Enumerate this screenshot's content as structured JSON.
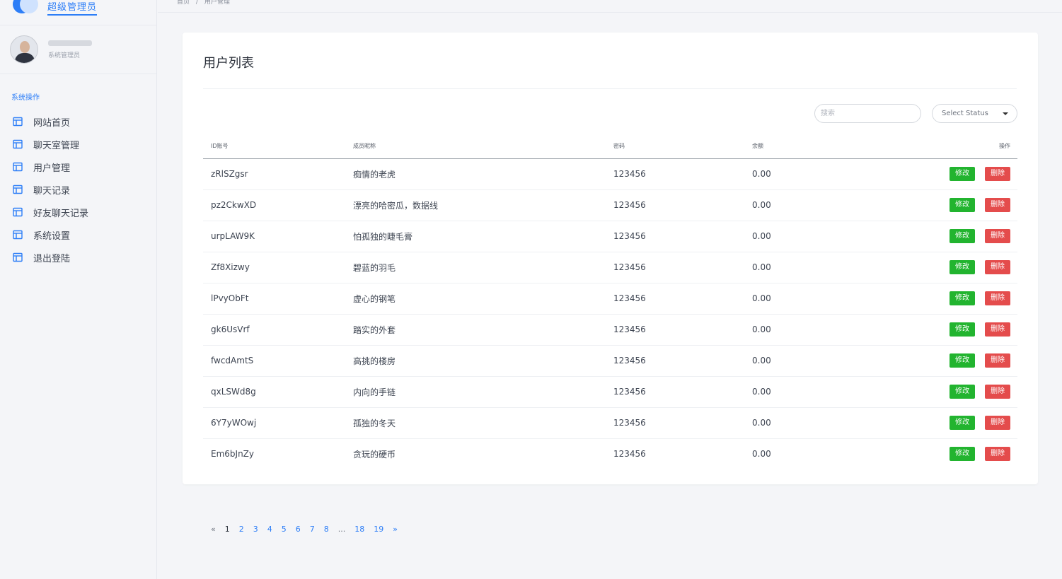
{
  "brand": {
    "title": "超级管理员"
  },
  "profile": {
    "role": "系统管理员"
  },
  "sidebar": {
    "section": "系统操作",
    "items": [
      {
        "label": "网站首页"
      },
      {
        "label": "聊天室管理"
      },
      {
        "label": "用户管理"
      },
      {
        "label": "聊天记录"
      },
      {
        "label": "好友聊天记录"
      },
      {
        "label": "系统设置"
      },
      {
        "label": "退出登陆"
      }
    ]
  },
  "breadcrumb": {
    "home": "首页",
    "sep": "/",
    "current": "用户管理"
  },
  "card": {
    "title": "用户列表",
    "search_placeholder": "搜索",
    "select_label": "Select Status"
  },
  "table": {
    "headers": {
      "id": "ID账号",
      "nickname": "成员昵称",
      "password": "密码",
      "balance": "余额",
      "ops": "操作"
    },
    "edit_label": "修改",
    "delete_label": "删除",
    "rows": [
      {
        "id": "zRlSZgsr",
        "nickname": "痴情的老虎",
        "password": "123456",
        "balance": "0.00"
      },
      {
        "id": "pz2CkwXD",
        "nickname": "漂亮的哈密瓜，数据线",
        "password": "123456",
        "balance": "0.00"
      },
      {
        "id": "urpLAW9K",
        "nickname": "怕孤独的睫毛膏",
        "password": "123456",
        "balance": "0.00"
      },
      {
        "id": "Zf8Xizwy",
        "nickname": "碧蓝的羽毛",
        "password": "123456",
        "balance": "0.00"
      },
      {
        "id": "lPvyObFt",
        "nickname": "虚心的钢笔",
        "password": "123456",
        "balance": "0.00"
      },
      {
        "id": "gk6UsVrf",
        "nickname": "踏实的外套",
        "password": "123456",
        "balance": "0.00"
      },
      {
        "id": "fwcdAmtS",
        "nickname": "高挑的楼房",
        "password": "123456",
        "balance": "0.00"
      },
      {
        "id": "qxLSWd8g",
        "nickname": "内向的手链",
        "password": "123456",
        "balance": "0.00"
      },
      {
        "id": "6Y7yWOwj",
        "nickname": "孤独的冬天",
        "password": "123456",
        "balance": "0.00"
      },
      {
        "id": "Em6bJnZy",
        "nickname": "贪玩的硬币",
        "password": "123456",
        "balance": "0.00"
      }
    ]
  },
  "pagination": {
    "prev": "«",
    "pages": [
      "1",
      "2",
      "3",
      "4",
      "5",
      "6",
      "7",
      "8",
      "...",
      "18",
      "19"
    ],
    "current": "1",
    "next": "»"
  },
  "colors": {
    "accent": "#2d7ef7",
    "edit": "#22b42f",
    "delete": "#e44c4c"
  }
}
